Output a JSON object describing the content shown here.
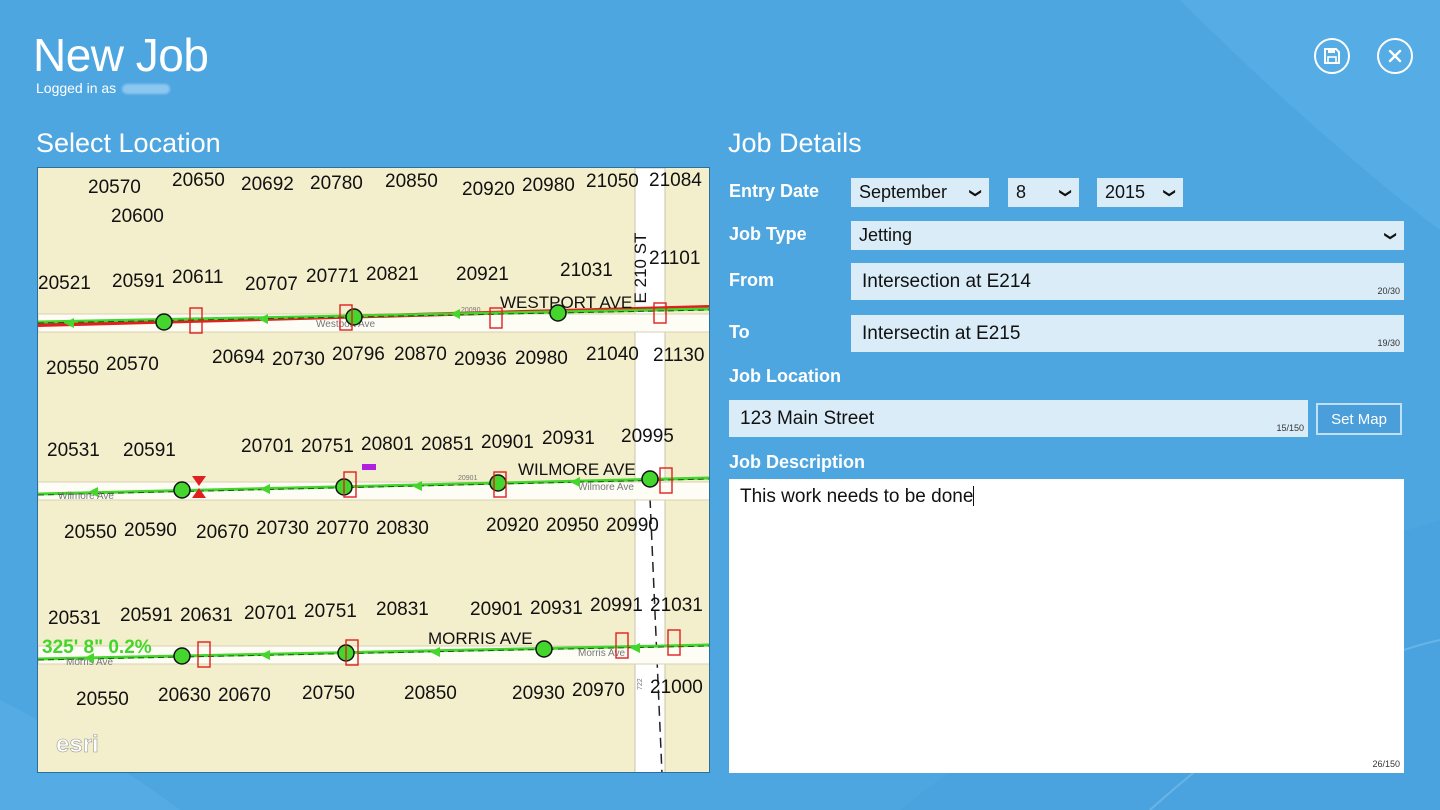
{
  "app": {
    "title": "New Job",
    "logged_in_label": "Logged in as"
  },
  "toolbar": {
    "save_icon": "save-icon",
    "close_icon": "close-icon"
  },
  "location_section": {
    "title": "Select Location",
    "map": {
      "attribution": "esri",
      "streets": [
        "WESTPORT AVE",
        "WILMORE AVE",
        "MORRIS AVE",
        "E 210 ST"
      ],
      "street_minor_labels": [
        "Westport Ave",
        "Wilmore Ave",
        "Morris Ave",
        "20090",
        "20901",
        "722"
      ],
      "measure_label": "325' 8\" 0.2%",
      "parcel_rows": [
        [
          "20570",
          "20650",
          "20692",
          "20780",
          "20850",
          "20920",
          "20980",
          "21050",
          "21084"
        ],
        [
          "20600"
        ],
        [
          "20521",
          "20591",
          "20611",
          "20707",
          "20771",
          "20821",
          "20921",
          "21031",
          "21101"
        ],
        [
          "20550",
          "20570",
          "20694",
          "20730",
          "20796",
          "20870",
          "20936",
          "20980",
          "21040",
          "21130"
        ],
        [
          "20531",
          "20591",
          "20701",
          "20751",
          "20801",
          "20851",
          "20901",
          "20931",
          "20995"
        ],
        [
          "20550",
          "20590",
          "20670",
          "20730",
          "20770",
          "20830",
          "20920",
          "20950",
          "20990"
        ],
        [
          "20531",
          "20591",
          "20631",
          "20701",
          "20751",
          "20831",
          "20901",
          "20931",
          "20991",
          "21031"
        ],
        [
          "20550",
          "20630",
          "20670",
          "20750",
          "20850",
          "20930",
          "20970",
          "21000"
        ]
      ]
    }
  },
  "details_section": {
    "title": "Job Details",
    "entry_date": {
      "label": "Entry Date",
      "month": "September",
      "day": "8",
      "year": "2015"
    },
    "job_type": {
      "label": "Job Type",
      "value": "Jetting"
    },
    "from": {
      "label": "From",
      "value": "Intersection at E214",
      "counter": "20/30"
    },
    "to": {
      "label": "To",
      "value": "Intersectin at E215",
      "counter": "19/30"
    },
    "job_location": {
      "label": "Job Location",
      "value": "123 Main Street",
      "counter": "15/150",
      "set_map_label": "Set Map"
    },
    "job_description": {
      "label": "Job Description",
      "value": "This work needs to be done",
      "counter": "26/150"
    }
  },
  "colors": {
    "background": "#4ea6e1",
    "field": "#daecf8",
    "map_bg": "#f3eecb",
    "main_line": "#44d62c",
    "pipe_red": "#e02020"
  }
}
